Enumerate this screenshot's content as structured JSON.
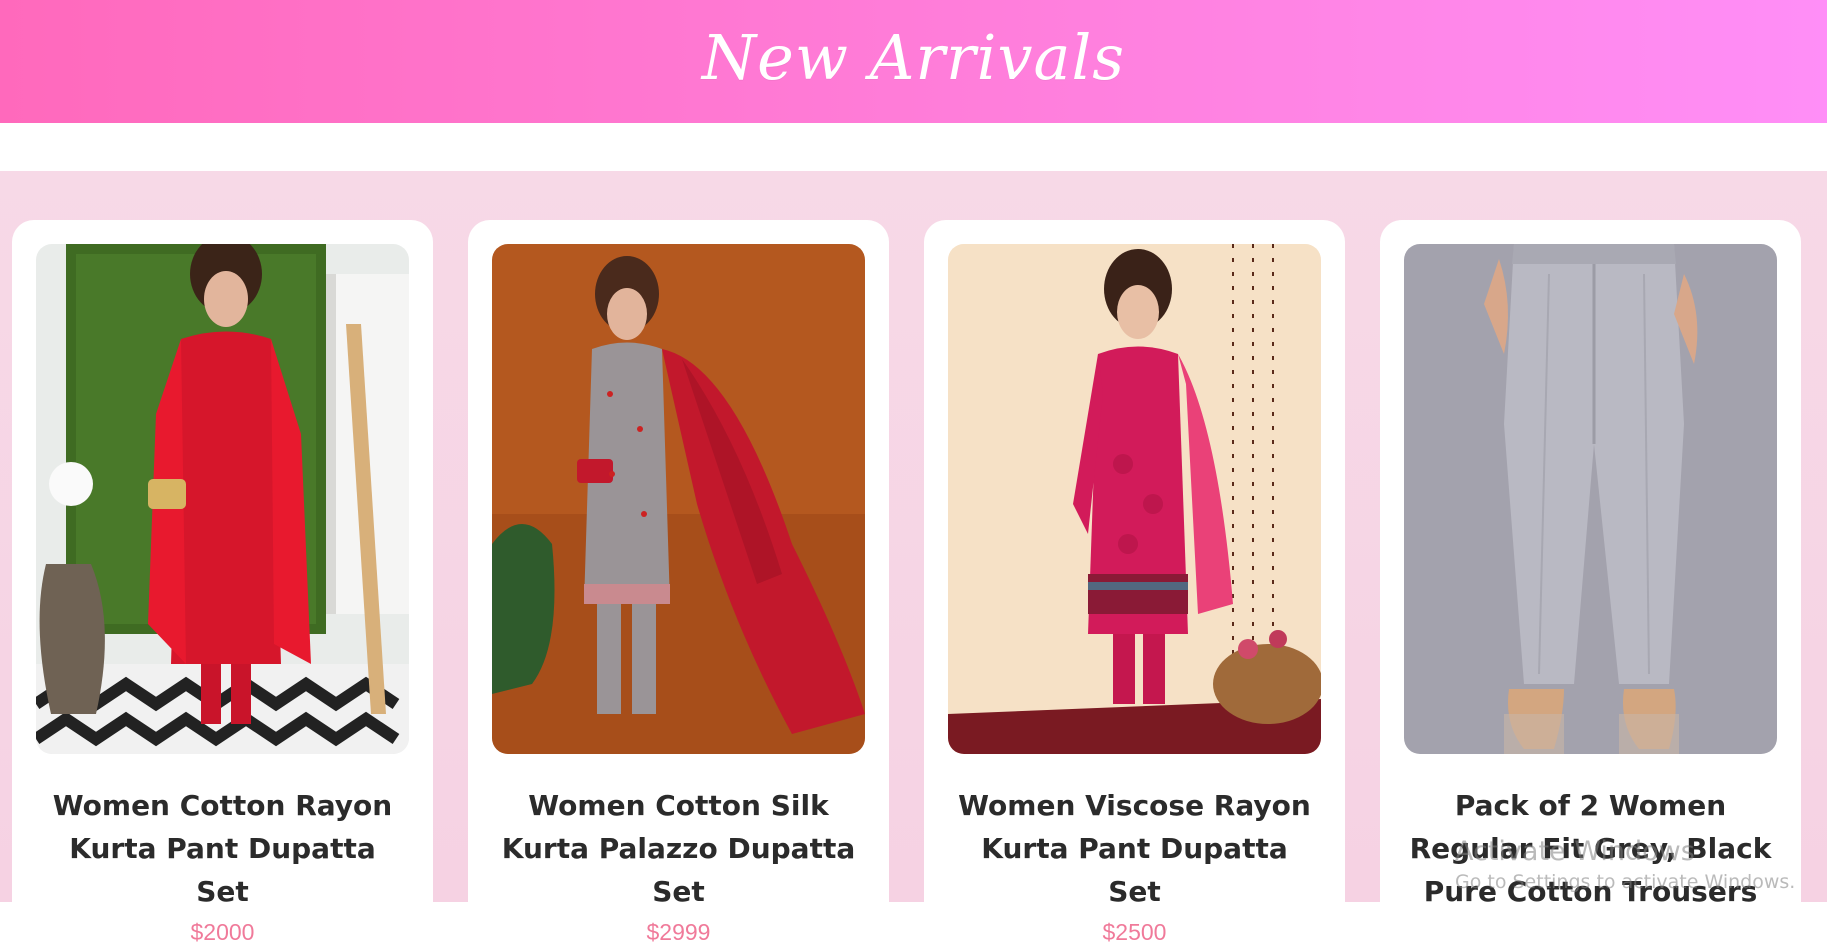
{
  "header": {
    "title": "New Arrivals"
  },
  "colors": {
    "header_gradient_start": "#ff69bc",
    "header_gradient_end": "#ff8ef7",
    "section_background": "#f7d9e7",
    "card_background": "#ffffff",
    "title_text": "#2b2b2b",
    "price_text": "#f07a9a"
  },
  "products": [
    {
      "name": "Women Cotton Rayon Kurta Pant Dupatta Set",
      "price": "$2000",
      "image_icon": "red-kurta-photo"
    },
    {
      "name": "Women Cotton Silk Kurta Palazzo Dupatta Set",
      "price": "$2999",
      "image_icon": "grey-kurta-photo"
    },
    {
      "name": "Women Viscose Rayon Kurta Pant Dupatta Set",
      "price": "$2500",
      "image_icon": "pink-kurta-photo"
    },
    {
      "name": "Pack of 2 Women Regular Fit Grey, Black Pure Cotton Trousers",
      "price": "",
      "image_icon": "grey-trousers-photo"
    }
  ],
  "watermark": {
    "title": "Activate Windows",
    "subtitle": "Go to Settings to activate Windows."
  }
}
